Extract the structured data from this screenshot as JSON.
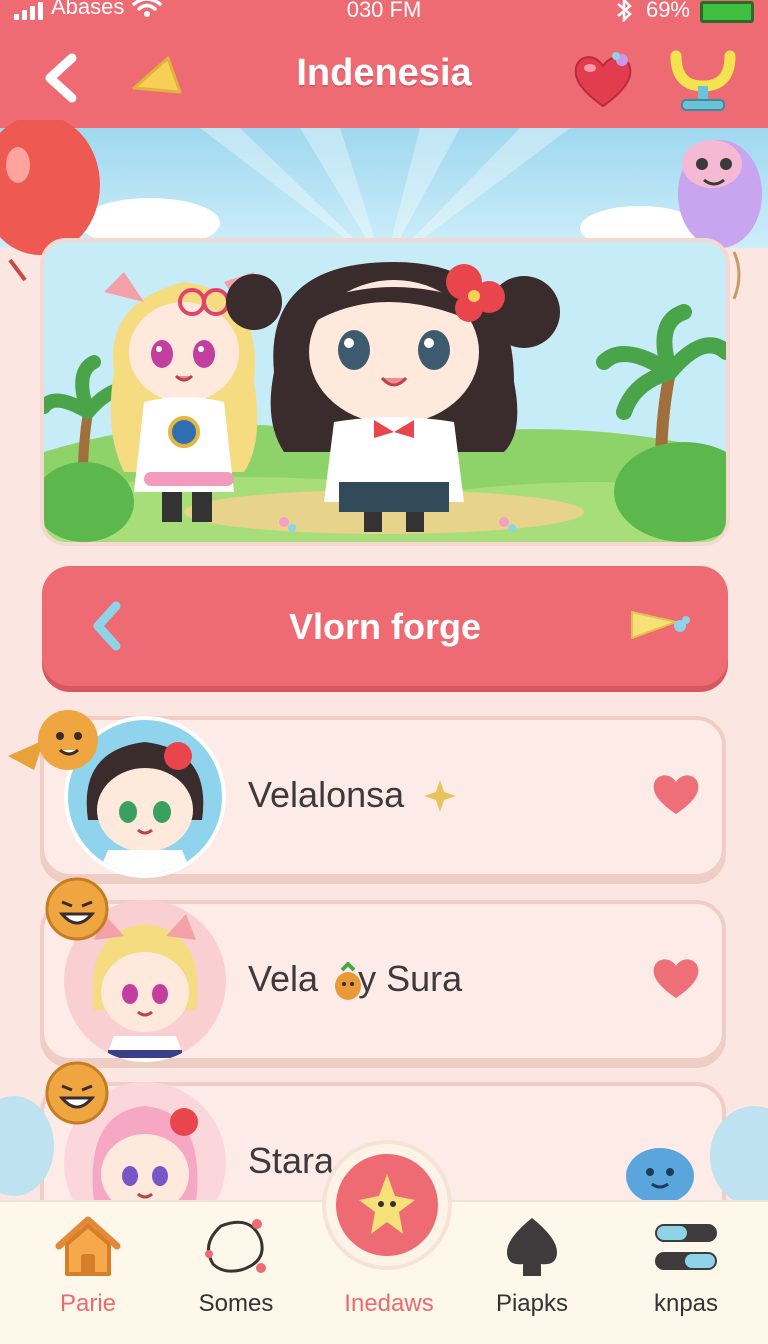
{
  "status_bar": {
    "carrier": "Abases",
    "time": "030 FM",
    "battery": "69%"
  },
  "header": {
    "title": "Indenesia"
  },
  "section": {
    "title": "Vlorn forge"
  },
  "list": [
    {
      "name": "Velalonsa"
    },
    {
      "name": "Vela    y Sura"
    },
    {
      "name": "Stara"
    }
  ],
  "nav": [
    {
      "label": "Parie",
      "icon": "home-icon",
      "active": true
    },
    {
      "label": "Somes",
      "icon": "bubble-icon",
      "active": false
    },
    {
      "label": "Inedaws",
      "icon": "star-icon",
      "active": false
    },
    {
      "label": "Piapks",
      "icon": "spade-icon",
      "active": false
    },
    {
      "label": "knpas",
      "icon": "toggles-icon",
      "active": false
    }
  ],
  "colors": {
    "primary": "#ee6b73",
    "background": "#fbe6e1",
    "nav_bg": "#fdf8ea",
    "active_label": "#ea6a72"
  }
}
